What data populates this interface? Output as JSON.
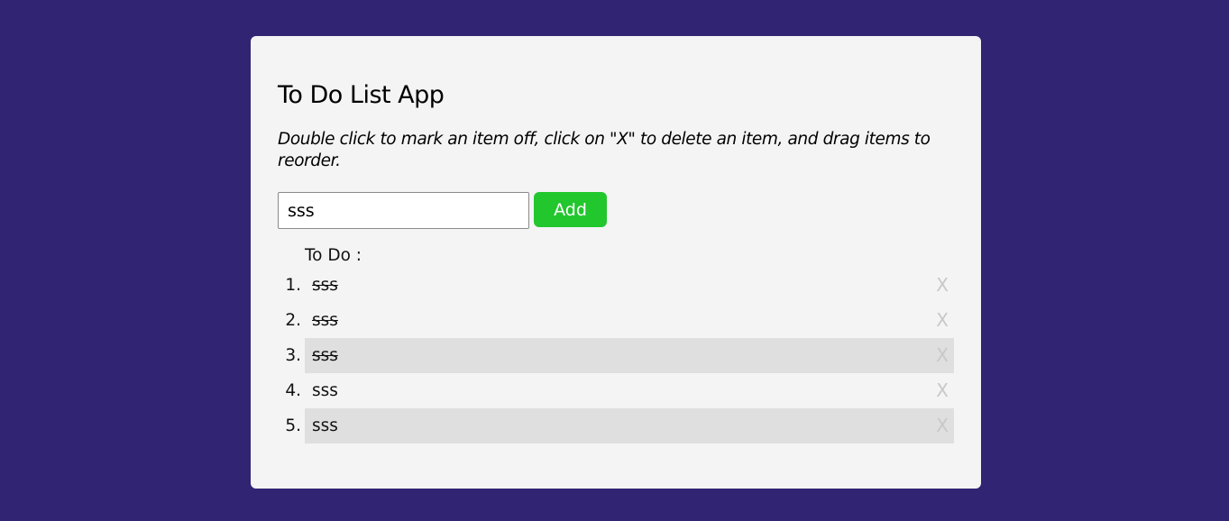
{
  "app": {
    "title": "To Do List App",
    "instructions": "Double click to mark an item off, click on \"X\" to delete an item, and drag items to reorder."
  },
  "input": {
    "value": "sss",
    "placeholder": ""
  },
  "add_button": {
    "label": "Add",
    "color": "#22c72e"
  },
  "list": {
    "heading": "To Do :",
    "items": [
      {
        "number": "1.",
        "text": "sss",
        "done": true,
        "highlighted": false,
        "delete_label": "X"
      },
      {
        "number": "2.",
        "text": "sss",
        "done": true,
        "highlighted": false,
        "delete_label": "X"
      },
      {
        "number": "3.",
        "text": "sss",
        "done": true,
        "highlighted": true,
        "delete_label": "X"
      },
      {
        "number": "4.",
        "text": "sss",
        "done": false,
        "highlighted": false,
        "delete_label": "X"
      },
      {
        "number": "5.",
        "text": "sss",
        "done": false,
        "highlighted": true,
        "delete_label": "X"
      }
    ]
  },
  "colors": {
    "page_background": "#312473",
    "card_background": "#f4f4f4",
    "row_highlight": "#dfdfdf",
    "delete_icon": "#c8c8c8"
  }
}
